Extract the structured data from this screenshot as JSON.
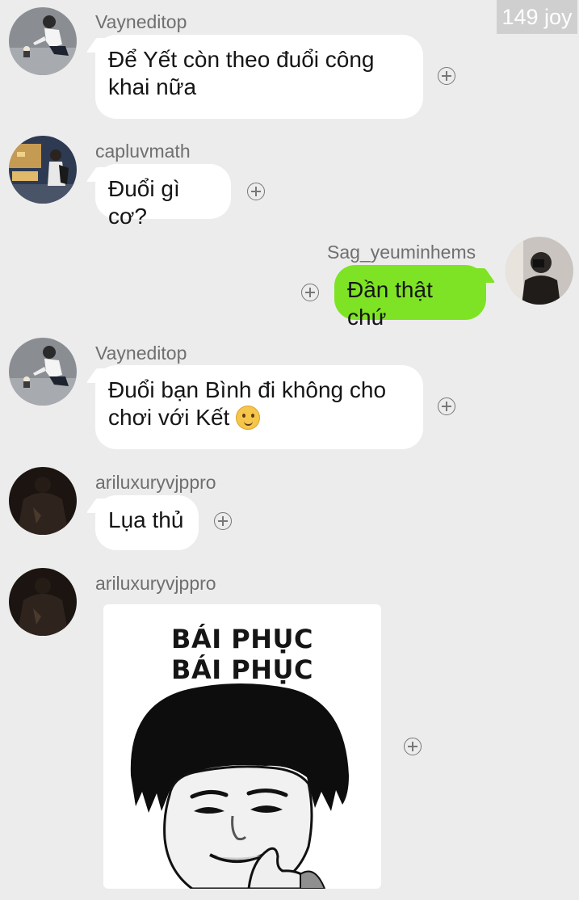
{
  "badge": {
    "text": "149 joy"
  },
  "messages": [
    {
      "username": "Vayneditop",
      "text_lines": [
        "Để Yết còn theo đuổi công",
        "khai nữa"
      ],
      "avatar": "avatar-person-with-cat"
    },
    {
      "username": "capluvmath",
      "text_lines": [
        "Đuổi gì cơ?"
      ],
      "avatar": "avatar-person-in-shop"
    },
    {
      "username": "Sag_yeuminhems",
      "text_lines": [
        "Đần thật chứ"
      ],
      "avatar": "avatar-mirror-selfie",
      "outgoing": true
    },
    {
      "username": "Vayneditop",
      "text_lines": [
        "Đuổi bạn Bình đi không cho",
        "chơi với Kết"
      ],
      "emoji": "slight-smile-emoji",
      "avatar": "avatar-person-with-cat"
    },
    {
      "username": "ariluxuryvjppro",
      "text_lines": [
        "Lụa thủ"
      ],
      "avatar": "avatar-dark-figure"
    },
    {
      "username": "ariluxuryvjppro",
      "sticker": {
        "line1": "BÁI PHỤC",
        "line2": "BÁI PHỤC"
      },
      "avatar": "avatar-dark-figure"
    }
  ],
  "colors": {
    "background": "#ececec",
    "incoming_bubble": "#ffffff",
    "outgoing_bubble": "#7ee324",
    "badge": "#cfcfcf"
  },
  "icons": {
    "react": "plus-circle-icon"
  }
}
